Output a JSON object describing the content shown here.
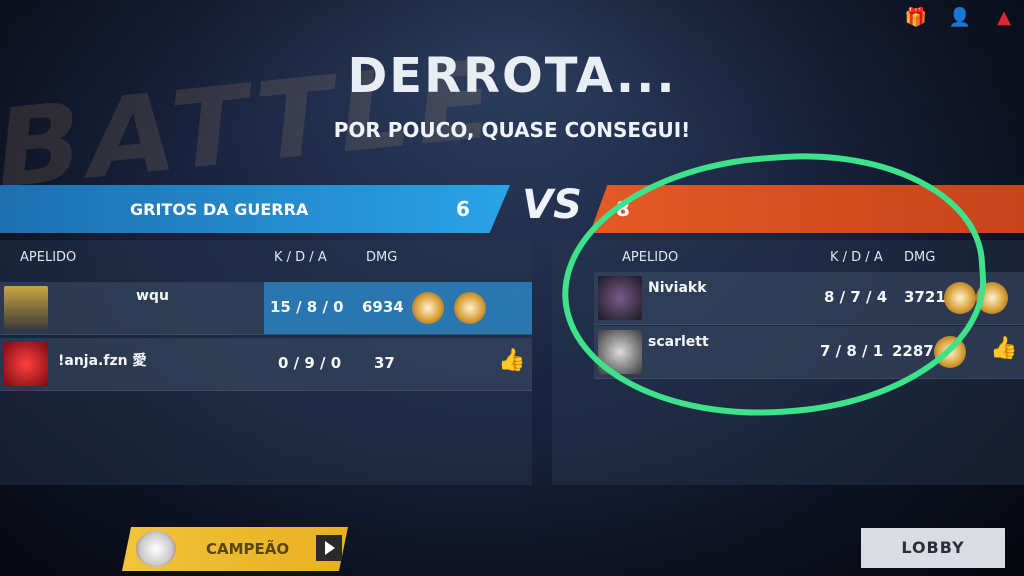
{
  "header": {
    "title": "DERROTA...",
    "subtitle": "POR POUCO, QUASE CONSEGUI!"
  },
  "top_icons": [
    "gift-icon",
    "profile-icon",
    "warning-icon"
  ],
  "vs_label": "VS",
  "teams": {
    "left": {
      "name": "GRITOS DA GUERRA",
      "score": "6",
      "color": "#2aa3e6"
    },
    "right": {
      "name": "",
      "score": "8",
      "color": "#e45a25"
    }
  },
  "columns": {
    "nickname": "APELIDO",
    "kda": "K / D / A",
    "dmg": "DMG"
  },
  "left_players": [
    {
      "name": "wqu",
      "kda": "15 / 8 / 0",
      "dmg": "6934"
    },
    {
      "name": "!anja.fzn 愛",
      "kda": "0 / 9 / 0",
      "dmg": "37"
    }
  ],
  "right_players": [
    {
      "name": "Niviakk",
      "kda": "8 / 7 / 4",
      "dmg": "3721"
    },
    {
      "name": "scarlett",
      "kda": "7 / 8 / 1",
      "dmg": "2287"
    }
  ],
  "buttons": {
    "champion": "CAMPEÃO",
    "lobby": "LOBBY"
  },
  "colors": {
    "highlight": "#3de28a",
    "champion_bg": "#f0c43a"
  }
}
